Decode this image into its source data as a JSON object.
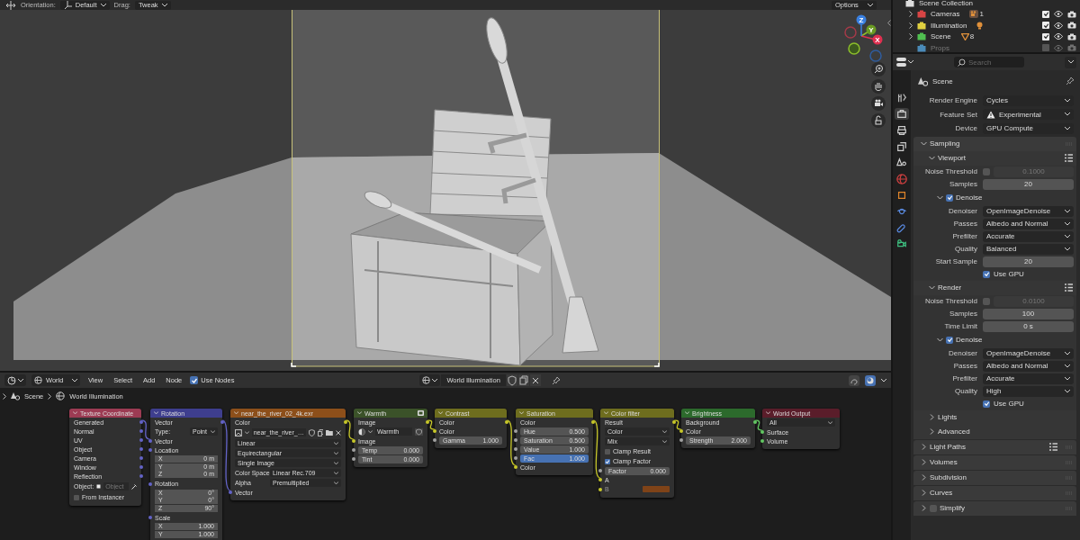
{
  "viewport": {
    "header": {
      "orientation_label": "Orientation:",
      "orientation": "Default",
      "drag_label": "Drag:",
      "drag": "Tweak",
      "options": "Options"
    },
    "gizmo": {
      "x": "X",
      "y": "Y",
      "z": "Z"
    }
  },
  "node_editor": {
    "header": {
      "shader_type": "World",
      "menus": [
        "View",
        "Select",
        "Add",
        "Node"
      ],
      "use_nodes": {
        "label": "Use Nodes",
        "checked": true
      },
      "datablock": "World Illumination"
    },
    "breadcrumbs": [
      "Scene",
      "World Illumination"
    ],
    "nodes": [
      {
        "title": "Texture Coordinate",
        "color": "#9c3b53",
        "is_group": false,
        "rows": [
          {
            "kind": "output",
            "label": "Generated",
            "socket": {
              "color": "#6363c7"
            }
          },
          {
            "kind": "output",
            "label": "Normal",
            "socket": {
              "color": "#6363c7"
            }
          },
          {
            "kind": "output",
            "label": "UV",
            "socket": {
              "color": "#6363c7"
            }
          },
          {
            "kind": "output",
            "label": "Object",
            "socket": {
              "color": "#6363c7"
            }
          },
          {
            "kind": "output",
            "label": "Camera",
            "socket": {
              "color": "#6363c7"
            }
          },
          {
            "kind": "output",
            "label": "Window",
            "socket": {
              "color": "#6363c7"
            }
          },
          {
            "kind": "output",
            "label": "Reflection",
            "socket": {
              "color": "#6363c7"
            }
          },
          {
            "kind": "object",
            "label": "Object:",
            "placeholder": "Object"
          },
          {
            "kind": "checkbox",
            "label": "From Instancer",
            "checked": false
          }
        ]
      },
      {
        "title": "Rotation",
        "color": "#3e3e8e",
        "is_group": false,
        "rows": [
          {
            "kind": "output",
            "label": "Vector",
            "socket": {
              "color": "#6363c7"
            }
          },
          {
            "kind": "dropdown",
            "label": "Type:",
            "value": "Point"
          },
          {
            "kind": "input",
            "label": "Vector",
            "socket": {
              "color": "#6363c7"
            }
          },
          {
            "kind": "input",
            "label": "Location",
            "socket": {
              "color": "#6363c7"
            }
          },
          {
            "kind": "vector",
            "items": [
              {
                "label": "X",
                "value": "0 m"
              },
              {
                "label": "Y",
                "value": "0 m"
              },
              {
                "label": "Z",
                "value": "0 m"
              }
            ]
          },
          {
            "kind": "input",
            "label": "Rotation",
            "socket": {
              "color": "#6363c7"
            }
          },
          {
            "kind": "vector",
            "items": [
              {
                "label": "X",
                "value": "0°"
              },
              {
                "label": "Y",
                "value": "0°"
              },
              {
                "label": "Z",
                "value": "90°"
              }
            ]
          },
          {
            "kind": "input",
            "label": "Scale",
            "socket": {
              "color": "#6363c7"
            }
          },
          {
            "kind": "vector",
            "items": [
              {
                "label": "X",
                "value": "1.000"
              },
              {
                "label": "Y",
                "value": "1.000"
              }
            ]
          }
        ]
      },
      {
        "title": "near_the_river_02_4k.exr",
        "color": "#8d4f1a",
        "is_group": false,
        "rows": [
          {
            "kind": "output",
            "label": "Color",
            "socket": {
              "color": "#c7c729"
            }
          },
          {
            "kind": "image",
            "value": "near_the_river_…"
          },
          {
            "kind": "dropdown",
            "value": "Linear"
          },
          {
            "kind": "dropdown",
            "value": "Equirectangular"
          },
          {
            "kind": "dropdown",
            "value": "Single Image"
          },
          {
            "kind": "dropdown",
            "label": "Color Space",
            "value": "Linear Rec.709"
          },
          {
            "kind": "dropdown",
            "label": "Alpha",
            "value": "Premultiplied"
          },
          {
            "kind": "input",
            "label": "Vector",
            "socket": {
              "color": "#6363c7"
            }
          }
        ]
      },
      {
        "title": "Warmth",
        "color": "#3b5229",
        "is_group": true,
        "rows": [
          {
            "kind": "output",
            "label": "Image",
            "socket": {
              "color": "#c7c729"
            }
          },
          {
            "kind": "group",
            "value": "Warmth"
          },
          {
            "kind": "input",
            "label": "Image",
            "socket": {
              "color": "#c7c729"
            }
          },
          {
            "kind": "field",
            "label": "Temp",
            "value": "0.000",
            "socket": {
              "color": "#a1a1a1"
            },
            "active": false
          },
          {
            "kind": "field",
            "label": "Tint",
            "value": "0.000",
            "socket": {
              "color": "#a1a1a1"
            },
            "active": false
          }
        ]
      },
      {
        "title": "Contrast",
        "color": "#6e6d1e",
        "is_group": false,
        "rows": [
          {
            "kind": "output",
            "label": "Color",
            "socket": {
              "color": "#c7c729"
            }
          },
          {
            "kind": "input",
            "label": "Color",
            "socket": {
              "color": "#c7c729"
            }
          },
          {
            "kind": "field",
            "label": "Gamma",
            "value": "1.000",
            "socket": {
              "color": "#a1a1a1"
            },
            "active": false
          }
        ]
      },
      {
        "title": "Saturation",
        "color": "#6e6d1e",
        "is_group": false,
        "rows": [
          {
            "kind": "output",
            "label": "Color",
            "socket": {
              "color": "#c7c729"
            }
          },
          {
            "kind": "field",
            "label": "Hue",
            "value": "0.500",
            "socket": {
              "color": "#a1a1a1"
            },
            "active": false
          },
          {
            "kind": "field",
            "label": "Saturation",
            "value": "0.500",
            "socket": {
              "color": "#a1a1a1"
            },
            "active": false
          },
          {
            "kind": "field",
            "label": "Value",
            "value": "1.000",
            "socket": {
              "color": "#a1a1a1"
            },
            "active": false
          },
          {
            "kind": "field",
            "label": "Fac",
            "value": "1.000",
            "socket": {
              "color": "#a1a1a1"
            },
            "active": true
          },
          {
            "kind": "input",
            "label": "Color",
            "socket": {
              "color": "#c7c729"
            }
          }
        ]
      },
      {
        "title": "Color filter",
        "color": "#6e6d1e",
        "is_group": false,
        "rows": [
          {
            "kind": "output",
            "label": "Result",
            "socket": {
              "color": "#c7c729"
            }
          },
          {
            "kind": "dropdown",
            "value": "Color"
          },
          {
            "kind": "dropdown",
            "value": "Mix"
          },
          {
            "kind": "checkbox",
            "label": "Clamp Result",
            "checked": false
          },
          {
            "kind": "checkbox",
            "label": "Clamp Factor",
            "checked": true
          },
          {
            "kind": "field",
            "label": "Factor",
            "value": "0.000",
            "socket": {
              "color": "#a1a1a1"
            },
            "active": false
          },
          {
            "kind": "input",
            "label": "A",
            "socket": {
              "color": "#c7c729"
            }
          },
          {
            "kind": "color_input",
            "label": "B",
            "socket": {
              "color": "#c7c729"
            },
            "color": "#7f4318"
          }
        ]
      },
      {
        "title": "Brightness",
        "color": "#2c6a2c",
        "is_group": false,
        "rows": [
          {
            "kind": "output",
            "label": "Background",
            "socket": {
              "color": "#63c763"
            }
          },
          {
            "kind": "input",
            "label": "Color",
            "socket": {
              "color": "#c7c729"
            }
          },
          {
            "kind": "field",
            "label": "Strength",
            "value": "2.000",
            "socket": {
              "color": "#a1a1a1"
            },
            "active": false
          }
        ]
      },
      {
        "title": "World Output",
        "color": "#5a1d2a",
        "is_group": false,
        "rows": [
          {
            "kind": "dropdown",
            "value": "All"
          },
          {
            "kind": "input",
            "label": "Surface",
            "socket": {
              "color": "#63c763"
            }
          },
          {
            "kind": "input",
            "label": "Volume",
            "socket": {
              "color": "#63c763"
            }
          }
        ]
      }
    ]
  },
  "outliner": {
    "root": "Scene Collection",
    "collections": [
      {
        "name": "Cameras",
        "color": "#d84545",
        "checked": true,
        "badge": {
          "kind": "camera",
          "count": "1"
        }
      },
      {
        "name": "Illumination",
        "color": "#e0d040",
        "checked": true,
        "badge": {
          "kind": "light"
        }
      },
      {
        "name": "Scene",
        "color": "#50c050",
        "checked": true,
        "badge": {
          "kind": "mesh",
          "count": "8"
        }
      },
      {
        "name": "Props",
        "color": "#4a8ab8",
        "checked": false
      }
    ]
  },
  "properties": {
    "search": {
      "placeholder": "Search"
    },
    "tabs": [
      {
        "kind": "tool",
        "selected": false
      },
      {
        "kind": "render",
        "selected": true
      },
      {
        "kind": "output",
        "selected": false
      },
      {
        "kind": "view_layer",
        "selected": false
      },
      {
        "kind": "scene",
        "selected": false
      },
      {
        "kind": "world",
        "selected": false
      },
      {
        "kind": "object",
        "selected": false
      },
      {
        "kind": "physics",
        "selected": false
      },
      {
        "kind": "constraints",
        "selected": false
      },
      {
        "kind": "data",
        "selected": false
      }
    ],
    "context": "Scene",
    "rows": [
      {
        "kind": "dropdown",
        "label": "Render Engine",
        "value": "Cycles",
        "warning": false
      },
      {
        "kind": "dropdown",
        "label": "Feature Set",
        "value": "Experimental",
        "warning": true
      },
      {
        "kind": "dropdown",
        "label": "Device",
        "value": "GPU Compute",
        "warning": false
      }
    ],
    "panels": [
      {
        "kind": "panel",
        "title": "Sampling",
        "expanded": true,
        "children": [
          {
            "kind": "subpanel",
            "title": "Viewport",
            "expanded": true,
            "presets": true,
            "children": [
              {
                "kind": "threshold",
                "label": "Noise Threshold",
                "checked": false,
                "value": "0.1000"
              },
              {
                "kind": "number",
                "label": "Samples",
                "value": "20"
              },
              {
                "kind": "subpanel",
                "title": "Denoise",
                "expanded": true,
                "checked": true,
                "children": [
                  {
                    "kind": "dropdown",
                    "label": "Denoiser",
                    "value": "OpenImageDenoise"
                  },
                  {
                    "kind": "dropdown",
                    "label": "Passes",
                    "value": "Albedo and Normal"
                  },
                  {
                    "kind": "dropdown",
                    "label": "Prefilter",
                    "value": "Accurate"
                  },
                  {
                    "kind": "dropdown",
                    "label": "Quality",
                    "value": "Balanced"
                  },
                  {
                    "kind": "number",
                    "label": "Start Sample",
                    "value": "20"
                  },
                  {
                    "kind": "checkbox",
                    "label": "Use GPU",
                    "checked": true
                  }
                ]
              }
            ]
          },
          {
            "kind": "subpanel",
            "title": "Render",
            "expanded": true,
            "presets": true,
            "children": [
              {
                "kind": "threshold",
                "label": "Noise Threshold",
                "checked": false,
                "value": "0.0100"
              },
              {
                "kind": "number",
                "label": "Samples",
                "value": "100"
              },
              {
                "kind": "number",
                "label": "Time Limit",
                "value": "0 s"
              },
              {
                "kind": "subpanel",
                "title": "Denoise",
                "expanded": true,
                "checked": true,
                "children": [
                  {
                    "kind": "dropdown",
                    "label": "Denoiser",
                    "value": "OpenImageDenoise"
                  },
                  {
                    "kind": "dropdown",
                    "label": "Passes",
                    "value": "Albedo and Normal"
                  },
                  {
                    "kind": "dropdown",
                    "label": "Prefilter",
                    "value": "Accurate"
                  },
                  {
                    "kind": "dropdown",
                    "label": "Quality",
                    "value": "High"
                  },
                  {
                    "kind": "checkbox",
                    "label": "Use GPU",
                    "checked": true
                  }
                ]
              }
            ]
          },
          {
            "kind": "subpanel",
            "title": "Lights",
            "expanded": false
          },
          {
            "kind": "subpanel",
            "title": "Advanced",
            "expanded": false
          }
        ]
      },
      {
        "kind": "panel",
        "title": "Light Paths",
        "expanded": false,
        "presets": true
      },
      {
        "kind": "panel",
        "title": "Volumes",
        "expanded": false
      },
      {
        "kind": "panel",
        "title": "Subdivision",
        "expanded": false
      },
      {
        "kind": "panel",
        "title": "Curves",
        "expanded": false
      },
      {
        "kind": "panel",
        "title": "Simplify",
        "expanded": false,
        "checked": false
      }
    ]
  }
}
